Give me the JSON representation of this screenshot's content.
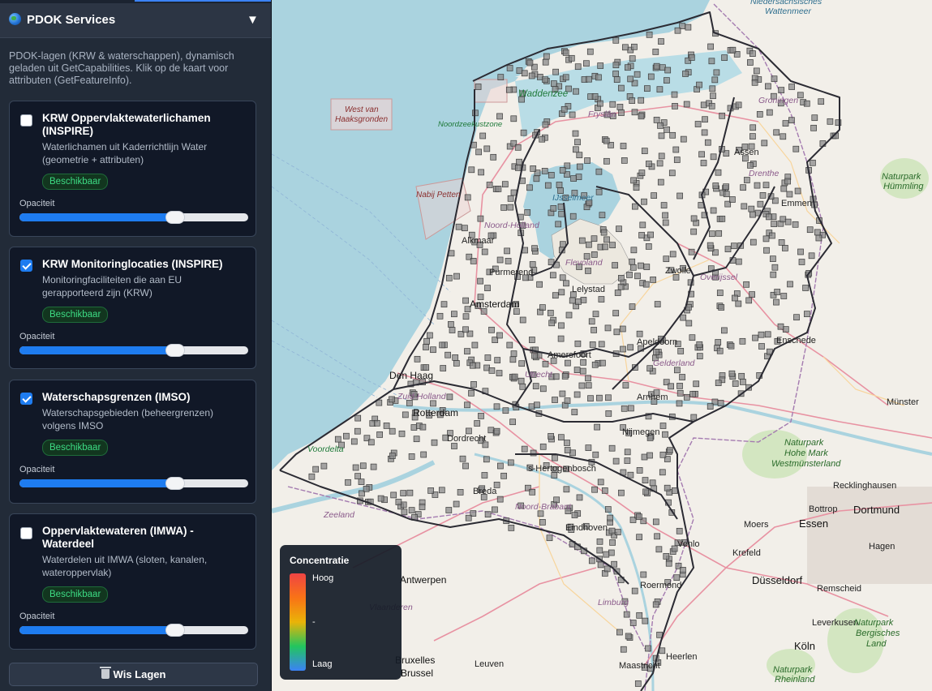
{
  "panel": {
    "title": "PDOK Services",
    "toggle_glyph": "▼",
    "description": "PDOK-lagen (KRW & waterschappen), dynamisch geladen uit GetCapabilities. Klik op de kaart voor attributen (GetFeatureInfo)."
  },
  "layers": [
    {
      "name": "KRW Oppervlaktewaterlichamen (INSPIRE)",
      "description": "Waterlichamen uit Kaderrichtlijn Water (geometrie + attributen)",
      "status": "Beschikbaar",
      "opacity_label": "Opaciteit",
      "opacity": 0.68,
      "checked": false
    },
    {
      "name": "KRW Monitoringlocaties (INSPIRE)",
      "description": "Monitoringfaciliteiten die aan EU gerapporteerd zijn (KRW)",
      "status": "Beschikbaar",
      "opacity_label": "Opaciteit",
      "opacity": 0.68,
      "checked": true
    },
    {
      "name": "Waterschapsgrenzen (IMSO)",
      "description": "Waterschapsgebieden (beheergrenzen) volgens IMSO",
      "status": "Beschikbaar",
      "opacity_label": "Opaciteit",
      "opacity": 0.68,
      "checked": true
    },
    {
      "name": "Oppervlaktewateren (IMWA) - Waterdeel",
      "description": "Waterdelen uit IMWA (sloten, kanalen, wateroppervlak)",
      "status": "Beschikbaar",
      "opacity_label": "Opaciteit",
      "opacity": 0.68,
      "checked": false
    }
  ],
  "clear_button": "Wis Lagen",
  "legend": {
    "title": "Concentratie",
    "high": "Hoog",
    "mid": "-",
    "low": "Laag"
  },
  "map_labels": {
    "wattenmeer_1": "Niedersächsisches",
    "wattenmeer_2": "Wattenmeer",
    "west_van_1": "West van",
    "west_van_2": "Haaksgronden",
    "waddenzee": "Waddenzee",
    "fryslan": "Fryslân",
    "noordzeekustzone": "Noordzeekustzone",
    "groningen": "Groningen",
    "assen": "Assen",
    "drenthe": "Drenthe",
    "emmen": "Emmen",
    "hummling_1": "Naturpark",
    "hummling_2": "Hümmling",
    "nabij_petten": "Nabij Petten",
    "ijsselmeer": "IJsselmeer",
    "noord_holland": "Noord-Holland",
    "alkmaar": "Alkmaar",
    "purmerend": "Purmerend",
    "flevoland": "Flevoland",
    "lelystad": "Lelystad",
    "zwolle": "Zwolle",
    "overijssel": "Overijssel",
    "amsterdam": "Amsterdam",
    "apeldoorn": "Apeldoorn",
    "amersfoort": "Amersfoort",
    "enschede": "Enschede",
    "gelderland": "Gelderland",
    "den_haag": "Den Haag",
    "zuid_holland": "Zuid-Holland",
    "utrecht": "Utrecht",
    "arnhem": "Arnhem",
    "munster": "Münster",
    "rotterdam": "Rotterdam",
    "dordrecht": "Dordrecht",
    "nijmegen": "Nijmegen",
    "voordelta": "Voordelta",
    "hohe_mark_1": "Naturpark",
    "hohe_mark_2": "Hohe Mark",
    "hohe_mark_3": "Westmünsterland",
    "s_hertogenbosch": "'s-Hertogenbosch",
    "breda": "Breda",
    "noord_brabant": "Noord-Brabant",
    "zeeland": "Zeeland",
    "recklinghausen": "Recklinghausen",
    "bottrop": "Bottrop",
    "dortmund": "Dortmund",
    "eindhoven": "Eindhoven",
    "moers": "Moers",
    "essen": "Essen",
    "venlo": "Venlo",
    "hagen": "Hagen",
    "krefeld": "Krefeld",
    "antwerpen": "Antwerpen",
    "roermond": "Roermond",
    "dusseldorf": "Düsseldorf",
    "remscheid": "Remscheid",
    "vlaanderen": "Vlaanderen",
    "limburg": "Limburg",
    "leverkusen": "Leverkusen",
    "bergisches_1": "Naturpark",
    "bergisches_2": "Bergisches",
    "bergisches_3": "Land",
    "bruxelles": "Bruxelles",
    "brussel": "Brussel",
    "leuven": "Leuven",
    "heerlen": "Heerlen",
    "koln": "Köln",
    "maastricht": "Maastricht",
    "rheinland_1": "Naturpark",
    "rheinland_2": "Rheinland"
  },
  "colors": {
    "sidebar_bg": "#222b38",
    "card_bg": "#111827",
    "accent": "#1e7cf0",
    "badge_text": "#3ddc84",
    "sea": "#aad3df",
    "land": "#f2efe9"
  }
}
